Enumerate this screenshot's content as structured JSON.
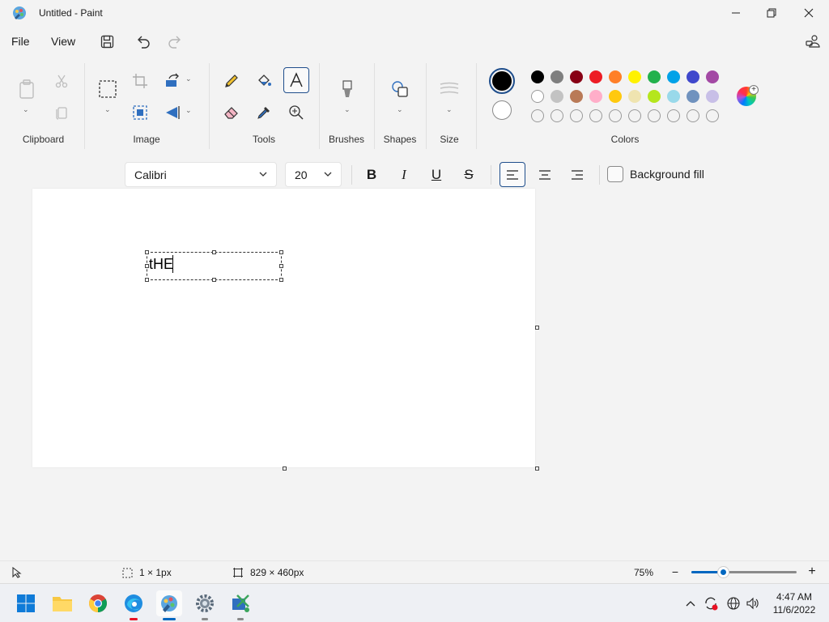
{
  "window": {
    "title": "Untitled - Paint",
    "controls": [
      "minimize-icon",
      "restore-icon",
      "close-icon"
    ]
  },
  "menu": {
    "file": "File",
    "view": "View",
    "icons": [
      "save-icon",
      "undo-icon",
      "redo-icon",
      "share-icon"
    ]
  },
  "ribbon": {
    "groups": {
      "clipboard": "Clipboard",
      "image": "Image",
      "tools": "Tools",
      "brushes": "Brushes",
      "shapes": "Shapes",
      "size": "Size",
      "colors": "Colors"
    },
    "active_tool": "text",
    "primary_color": "#000000",
    "secondary_color": "#ffffff",
    "palette_row1": [
      "#000000",
      "#7f7f7f",
      "#880015",
      "#ed1c24",
      "#ff7f27",
      "#fff200",
      "#22b14c",
      "#00a2e8",
      "#3f48cc",
      "#a349a4"
    ],
    "palette_row2": [
      "#ffffff",
      "#c3c3c3",
      "#b97a57",
      "#ffaec9",
      "#ffc90e",
      "#efe4b0",
      "#b5e61d",
      "#99d9ea",
      "#7092be",
      "#c8bfe7"
    ]
  },
  "text_toolbar": {
    "font": "Calibri",
    "size": "20",
    "bold": "B",
    "italic": "I",
    "underline": "U",
    "strike": "S",
    "background_fill": "Background fill",
    "alignment": "left"
  },
  "canvas": {
    "text": "tHE"
  },
  "status": {
    "selection": "1 × 1px",
    "canvas_size": "829 × 460px",
    "zoom": "75%",
    "zoom_level": 0.3
  },
  "taskbar": {
    "apps": [
      "start-icon",
      "file-explorer-icon",
      "chrome-icon",
      "edge-icon",
      "paint-icon",
      "settings-icon",
      "snipping-tool-icon"
    ],
    "time": "4:47 AM",
    "date": "11/6/2022"
  }
}
